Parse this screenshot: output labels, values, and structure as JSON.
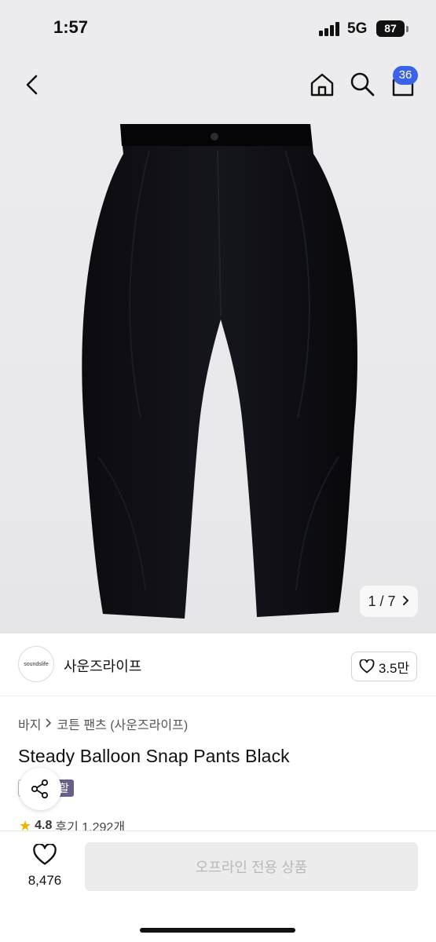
{
  "status_bar": {
    "time": "1:57",
    "network": "5G",
    "battery": "87"
  },
  "header": {
    "cart_count": "36",
    "icons": [
      "back-icon",
      "home-icon",
      "search-icon",
      "cart-icon"
    ]
  },
  "gallery": {
    "counter": "1 / 7",
    "next_icon": "chevron-right-icon"
  },
  "seller": {
    "logo_text": "soundslife",
    "name": "사운즈라이프",
    "likes": "3.5만"
  },
  "breadcrumb": [
    "바지",
    "코튼 팬츠 (사운즈라이프)"
  ],
  "product": {
    "title": "Steady Balloon Snap Pants Black",
    "sale_badge": "할세일"
  },
  "rating": {
    "score": "4.8",
    "reviews": "후기 1,292개"
  },
  "bottom_bar": {
    "wish_count": "8,476",
    "cta_label": "오프라인 전용 상품"
  },
  "colors": {
    "badge_blue": "#3b63e8",
    "sale_purple": "#6a5f87",
    "star": "#f0b400",
    "cta_bg": "#ececec"
  }
}
